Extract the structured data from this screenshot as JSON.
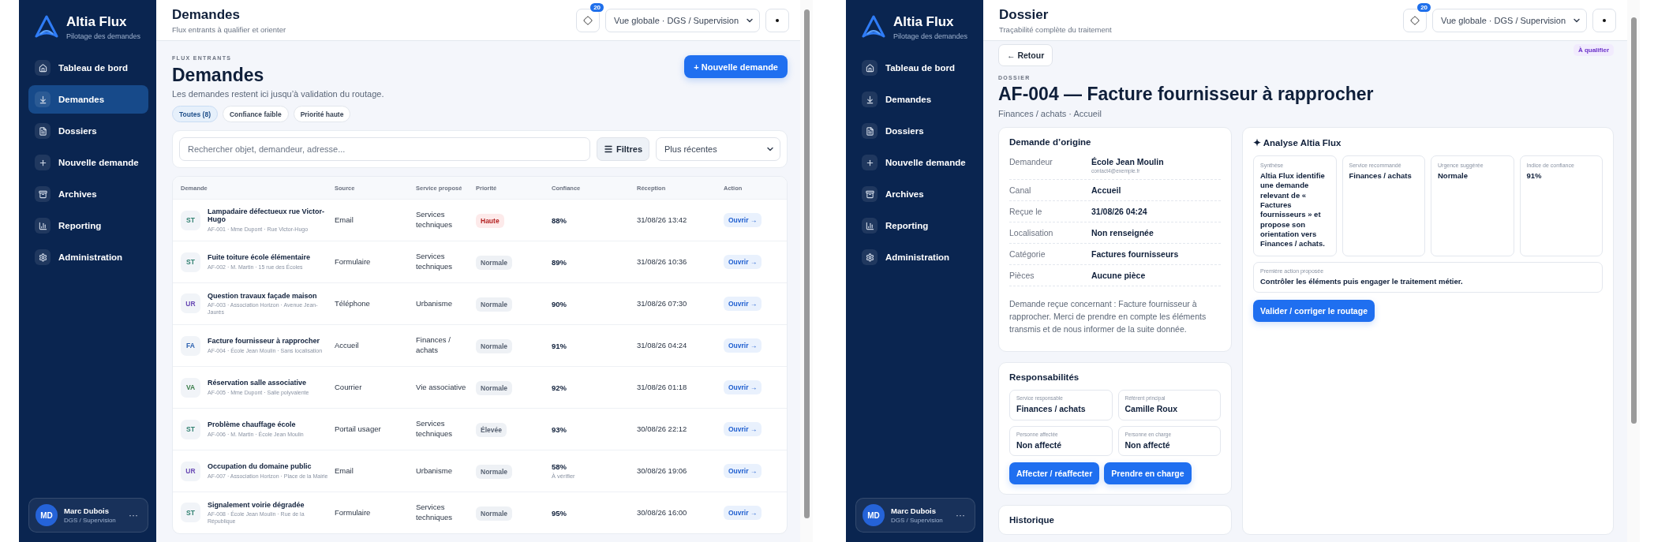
{
  "windows": [
    {
      "kind": "list",
      "sidebar": {
        "brand": {
          "name": "Altia Flux",
          "tagline": "Pilotage des demandes"
        },
        "nav": [
          {
            "label": "Tableau de bord",
            "selected": false
          },
          {
            "label": "Demandes",
            "selected": true
          },
          {
            "label": "Dossiers",
            "selected": false
          },
          {
            "label": "Nouvelle demande",
            "selected": false
          },
          {
            "label": "Archives",
            "selected": false
          },
          {
            "label": "Reporting",
            "selected": false
          },
          {
            "label": "Administration",
            "selected": false
          }
        ],
        "user": {
          "initials": "MD",
          "name": "Marc Dubois",
          "role": "DGS / Supervision",
          "menu": "···"
        }
      },
      "topbar": {
        "title": "Demandes",
        "subtitle": "Flux entrants à qualifier et orienter",
        "notification_count": "20",
        "view_select": "Vue globale · DGS / Supervision"
      },
      "page": {
        "eyebrow": "FLUX ENTRANTS",
        "title": "Demandes",
        "description": "Les demandes restent ici jusqu’à validation du routage.",
        "new_button": "+ Nouvelle demande",
        "chips": [
          {
            "label": "Toutes (8)",
            "selected": true
          },
          {
            "label": "Confiance faible",
            "selected": false
          },
          {
            "label": "Priorité haute",
            "selected": false
          }
        ],
        "search": {
          "placeholder": "Rechercher objet, demandeur, adresse..."
        },
        "filter_button": "Filtres",
        "sort_select": "Plus récentes",
        "table": {
          "columns": [
            "Demande",
            "Source",
            "Service proposé",
            "Priorité",
            "Confiance",
            "Réception",
            "Action"
          ],
          "rows": [
            {
              "initials": "ST",
              "color": "#2f7f6f",
              "title": "Lampadaire défectueux rue Victor-Hugo",
              "meta": "AF-001 · Mme Dupont · Rue Victor-Hugo",
              "source": "Email",
              "service": "Services techniques",
              "priority": {
                "label": "Haute",
                "kind": "high"
              },
              "confidence": "88%",
              "received": "31/08/26 13:42",
              "action": "Ouvrir →"
            },
            {
              "initials": "ST",
              "color": "#2f7f6f",
              "title": "Fuite toiture école élémentaire",
              "meta": "AF-002 · M. Martin · 15 rue des Écoles",
              "source": "Formulaire",
              "service": "Services techniques",
              "priority": {
                "label": "Normale",
                "kind": "normal"
              },
              "confidence": "89%",
              "received": "31/08/26 10:36",
              "action": "Ouvrir →"
            },
            {
              "initials": "UR",
              "color": "#6a4bb5",
              "title": "Question travaux façade maison",
              "meta": "AF-003 · Association Horizon · Avenue Jean-Jaurès",
              "source": "Téléphone",
              "service": "Urbanisme",
              "priority": {
                "label": "Normale",
                "kind": "normal"
              },
              "confidence": "90%",
              "received": "31/08/26 07:30",
              "action": "Ouvrir →"
            },
            {
              "initials": "FA",
              "color": "#2d62b0",
              "title": "Facture fournisseur à rapprocher",
              "meta": "AF-004 · École Jean Moulin · Sans localisation",
              "source": "Accueil",
              "service": "Finances / achats",
              "priority": {
                "label": "Normale",
                "kind": "normal"
              },
              "confidence": "91%",
              "received": "31/08/26 04:24",
              "action": "Ouvrir →"
            },
            {
              "initials": "VA",
              "color": "#3a7d4a",
              "title": "Réservation salle associative",
              "meta": "AF-005 · Mme Dupont · Salle polyvalente",
              "source": "Courrier",
              "service": "Vie associative",
              "priority": {
                "label": "Normale",
                "kind": "normal"
              },
              "confidence": "92%",
              "received": "31/08/26 01:18",
              "action": "Ouvrir →"
            },
            {
              "initials": "ST",
              "color": "#2f7f6f",
              "title": "Problème chauffage école",
              "meta": "AF-006 · M. Martin · École Jean Moulin",
              "source": "Portail usager",
              "service": "Services techniques",
              "priority": {
                "label": "Élevée",
                "kind": "normal"
              },
              "confidence": "93%",
              "received": "30/08/26 22:12",
              "action": "Ouvrir →"
            },
            {
              "initials": "UR",
              "color": "#6a4bb5",
              "title": "Occupation du domaine public",
              "meta": "AF-007 · Association Horizon · Place de la Mairie",
              "source": "Email",
              "service": "Urbanisme",
              "priority": {
                "label": "Normale",
                "kind": "normal"
              },
              "confidence": "58%",
              "confidence_note": "À vérifier",
              "received": "30/08/26 19:06",
              "action": "Ouvrir →"
            },
            {
              "initials": "ST",
              "color": "#2f7f6f",
              "title": "Signalement voirie dégradée",
              "meta": "AF-008 · École Jean Moulin · Rue de la République",
              "source": "Formulaire",
              "service": "Services techniques",
              "priority": {
                "label": "Normale",
                "kind": "normal"
              },
              "confidence": "95%",
              "received": "30/08/26 16:00",
              "action": "Ouvrir →"
            }
          ]
        }
      }
    },
    {
      "kind": "detail",
      "sidebar": {
        "brand": {
          "name": "Altia Flux",
          "tagline": "Pilotage des demandes"
        },
        "nav": [
          {
            "label": "Tableau de bord",
            "selected": false
          },
          {
            "label": "Demandes",
            "selected": false
          },
          {
            "label": "Dossiers",
            "selected": false
          },
          {
            "label": "Nouvelle demande",
            "selected": false
          },
          {
            "label": "Archives",
            "selected": false
          },
          {
            "label": "Reporting",
            "selected": false
          },
          {
            "label": "Administration",
            "selected": false
          }
        ],
        "user": {
          "initials": "MD",
          "name": "Marc Dubois",
          "role": "DGS / Supervision",
          "menu": "···"
        }
      },
      "topbar": {
        "title": "Dossier",
        "subtitle": "Traçabilité complète du traitement",
        "notification_count": "20",
        "view_select": "Vue globale · DGS / Supervision"
      },
      "page": {
        "back_button": "← Retour",
        "status_badge": "À qualifier",
        "eyebrow": "DOSSIER",
        "title": "AF-004 — Facture fournisseur à rapprocher",
        "subtitle": "Finances / achats · Accueil",
        "origin": {
          "title": "Demande d’origine",
          "fields": [
            {
              "label": "Demandeur",
              "value": "École Jean Moulin",
              "note": "contact4@exemple.fr"
            },
            {
              "label": "Canal",
              "value": "Accueil"
            },
            {
              "label": "Reçue le",
              "value": "31/08/26 04:24"
            },
            {
              "label": "Localisation",
              "value": "Non renseignée"
            },
            {
              "label": "Catégorie",
              "value": "Factures fournisseurs"
            },
            {
              "label": "Pièces",
              "value": "Aucune pièce"
            }
          ],
          "message": "Demande reçue concernant : Facture fournisseur à rapprocher. Merci de prendre en compte les éléments transmis et de nous informer de la suite donnée."
        },
        "responsibilities": {
          "title": "Responsabilités",
          "fields": [
            {
              "label": "Service responsable",
              "value": "Finances / achats"
            },
            {
              "label": "Référent principal",
              "value": "Camille Roux"
            },
            {
              "label": "Personne affectée",
              "value": "Non affecté"
            },
            {
              "label": "Personne en charge",
              "value": "Non affecté"
            }
          ],
          "buttons": [
            "Affecter / réaffecter",
            "Prendre en charge"
          ]
        },
        "history": {
          "title": "Historique"
        },
        "analysis": {
          "title": "✦ Analyse Altia Flux",
          "cells": [
            {
              "label": "Synthèse",
              "value": "Altia Flux identifie une demande relevant de « Factures fournisseurs » et propose son orientation vers Finances / achats."
            },
            {
              "label": "Service recommandé",
              "value": "Finances / achats"
            },
            {
              "label": "Urgence suggérée",
              "value": "Normale"
            },
            {
              "label": "Indice de confiance",
              "value": "91%"
            }
          ],
          "action": {
            "label": "Première action proposée",
            "value": "Contrôler les éléments puis engager le traitement métier."
          },
          "button": "Valider / corriger le routage"
        }
      }
    }
  ]
}
